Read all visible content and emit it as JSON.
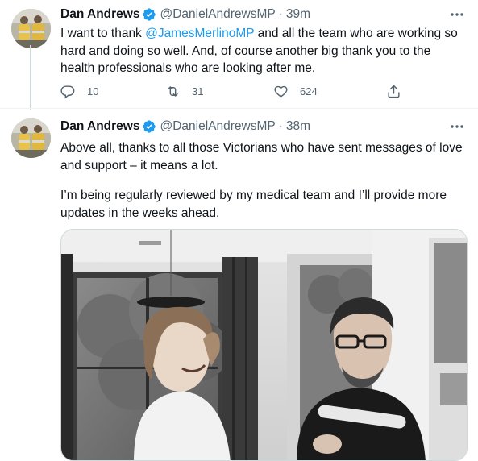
{
  "tweets": [
    {
      "author": "Dan Andrews",
      "handle": "@DanielAndrewsMP",
      "separator": "·",
      "time": "39m",
      "text_before": "I want to thank ",
      "mention": "@JamesMerlinoMP",
      "text_after": " and all the team who are working so hard and doing so well. And, of course another big thank you to the health professionals who are looking after me.",
      "reply_count": "10",
      "retweet_count": "31",
      "like_count": "624"
    },
    {
      "author": "Dan Andrews",
      "handle": "@DanielAndrewsMP",
      "separator": "·",
      "time": "38m",
      "paragraph1": "Above all, thanks to all those Victorians who have sent messages of love and support – it means a lot.",
      "paragraph2": "I’m being regularly reviewed by my medical team and I’ll provide more updates in the weeks ahead."
    }
  ],
  "icons": {
    "more": "more-icon",
    "verified": "verified-badge-icon",
    "reply": "reply-icon",
    "retweet": "retweet-icon",
    "like": "like-icon",
    "share": "share-icon"
  },
  "colors": {
    "link": "#1d9bf0",
    "secondary_text": "#536471",
    "verified": "#1d9bf0",
    "divider": "#eff3f4"
  }
}
